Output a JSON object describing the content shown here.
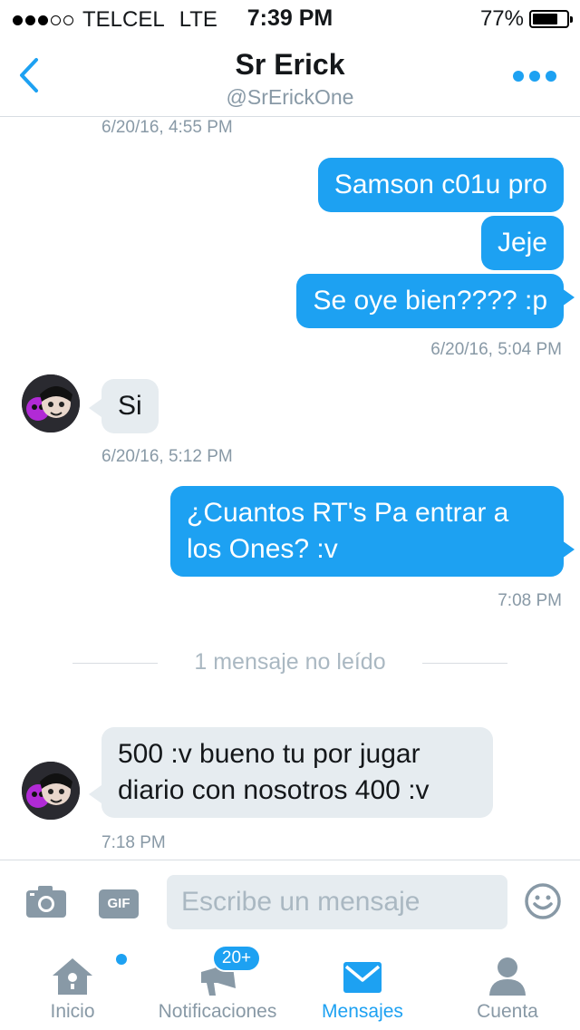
{
  "status_bar": {
    "carrier": "TELCEL",
    "network": "LTE",
    "time": "7:39 PM",
    "battery": "77%",
    "battery_level": 0.77
  },
  "header": {
    "title": "Sr Erick",
    "handle": "@SrErickOne"
  },
  "messages": {
    "ts1": "6/20/16, 4:55 PM",
    "out1": "Samson c01u pro",
    "out2": "Jeje",
    "out3": "Se oye bien???? :p",
    "ts2": "6/20/16, 5:04 PM",
    "in1": "Si",
    "ts3": "6/20/16, 5:12 PM",
    "out4_line1": "¿Cuantos RT's Pa entrar a",
    "out4_line2": "los Ones? :v",
    "ts4": "7:08 PM",
    "unread": "1 mensaje no leído",
    "in2_line1": "500 :v bueno tu por jugar",
    "in2_line2": "diario con nosotros 400 :v",
    "ts5": "7:18 PM"
  },
  "composer": {
    "gif_label": "GIF",
    "placeholder": "Escribe un mensaje"
  },
  "tabs": {
    "home": "Inicio",
    "notifications": "Notificaciones",
    "notifications_badge": "20+",
    "messages": "Mensajes",
    "account": "Cuenta"
  },
  "colors": {
    "accent": "#1da1f2",
    "incoming_bubble": "#e6ecf0",
    "muted_text": "#8899a6"
  }
}
